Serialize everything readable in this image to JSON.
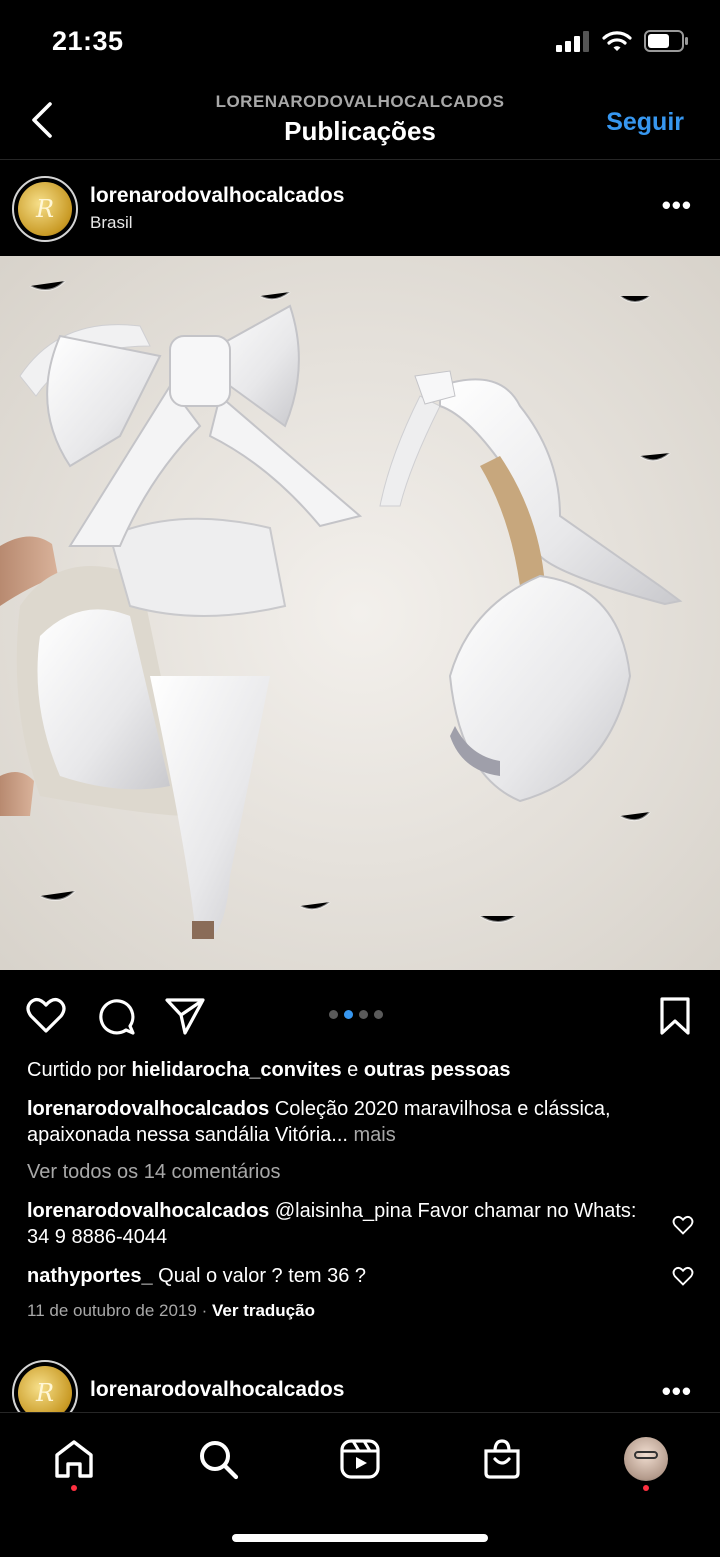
{
  "status": {
    "time": "21:35"
  },
  "header": {
    "subtitle": "LORENARODOVALHOCALCADOS",
    "title": "Publicações",
    "follow_label": "Seguir"
  },
  "post": {
    "username": "lorenarodovalhocalcados",
    "location": "Brasil",
    "more": "•••",
    "carousel": {
      "count": 4,
      "active": 2
    },
    "likes": {
      "prefix": "Curtido por ",
      "user": "hielidarocha_convites",
      "middle": " e ",
      "others": "outras pessoas"
    },
    "caption": {
      "user": "lorenarodovalhocalcados",
      "text": " Coleção 2020 maravilhosa e clássica, apaixonada nessa sandália Vitória...",
      "more": " mais"
    },
    "view_comments": "Ver todos os 14 comentários",
    "comments": [
      {
        "user": "lorenarodovalhocalcados",
        "text": " @laisinha_pina Favor chamar no Whats: 34 9 8886-4044"
      },
      {
        "user": "nathyportes_",
        "text": " Qual o valor ? tem 36 ?"
      }
    ],
    "date": "11 de outubro de 2019",
    "separator": "·",
    "translate": "Ver tradução"
  },
  "next_post": {
    "username": "lorenarodovalhocalcados",
    "more": "•••"
  },
  "avatar_letter": "R",
  "colors": {
    "accent": "#3797f0",
    "notification": "#ff3040",
    "muted": "#a8a8a8"
  },
  "icons": {
    "post_actions": [
      "heart-icon",
      "comment-icon",
      "share-icon",
      "bookmark-icon"
    ],
    "tab_bar": [
      "home-icon",
      "search-icon",
      "reels-icon",
      "shop-icon",
      "profile-avatar"
    ]
  }
}
